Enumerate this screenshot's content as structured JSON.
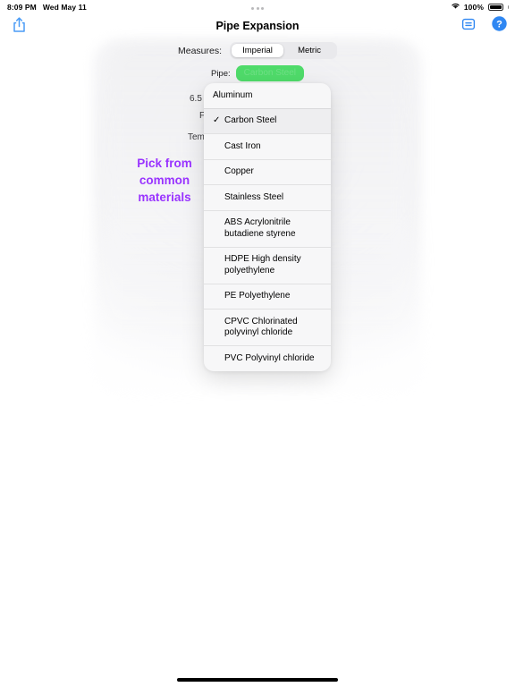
{
  "status_bar": {
    "time": "8:09 PM",
    "date": "Wed May 11",
    "wifi_icon": "wifi-icon",
    "battery_percent": "100%",
    "multitask_icon": "three-dots-icon"
  },
  "nav_bar": {
    "title": "Pipe Expansion",
    "share_icon": "share-icon",
    "notes_icon": "notes-icon",
    "help_icon": "help-question-icon"
  },
  "form": {
    "measures_label": "Measures:",
    "segments": [
      {
        "label": "Imperial",
        "selected": true
      },
      {
        "label": "Metric",
        "selected": false
      }
    ],
    "pipe_label": "Pipe:",
    "pipe_value": "Carbon Steel",
    "pipe_value_color": "#4fdb6a",
    "background_fields": {
      "diameter_value": "6.5",
      "material_partial": "F",
      "temperature_partial": "Tem"
    }
  },
  "material_menu": {
    "checkmark_glyph": "✓",
    "items": [
      {
        "label": "Aluminum",
        "selected": false
      },
      {
        "label": "Carbon Steel",
        "selected": true
      },
      {
        "label": "Cast Iron",
        "selected": false
      },
      {
        "label": "Copper",
        "selected": false
      },
      {
        "label": "Stainless Steel",
        "selected": false
      },
      {
        "label": "ABS Acrylonitrile butadiene styrene",
        "selected": false
      },
      {
        "label": "HDPE High density polyethylene",
        "selected": false
      },
      {
        "label": "PE Polyethylene",
        "selected": false
      },
      {
        "label": "CPVC Chlorinated polyvinyl chloride",
        "selected": false
      },
      {
        "label": "PVC Polyvinyl chloride",
        "selected": false
      }
    ]
  },
  "annotation": {
    "text": "Pick from common materials",
    "color": "#9933ff"
  }
}
